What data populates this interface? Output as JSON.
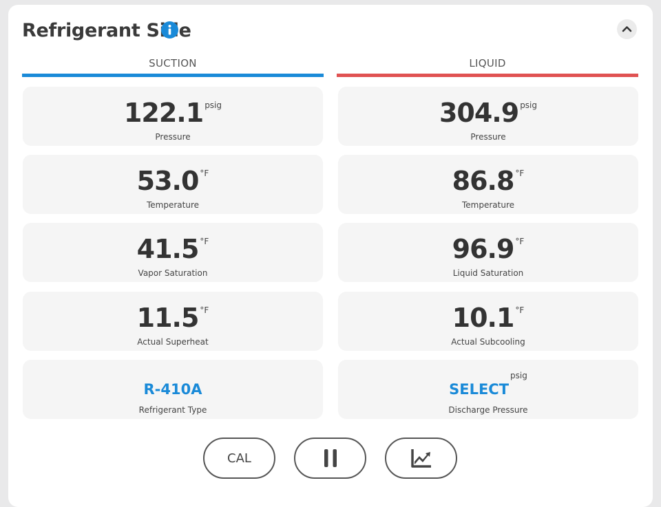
{
  "header": {
    "title": "Refrigerant Side"
  },
  "columns": [
    {
      "heading": "SUCTION",
      "color": "#1a8ad8",
      "tiles": [
        {
          "value": "122.1",
          "unit": "psig",
          "label": "Pressure"
        },
        {
          "value": "53.0",
          "unit": "°F",
          "label": "Temperature"
        },
        {
          "value": "41.5",
          "unit": "°F",
          "label": "Vapor Saturation"
        },
        {
          "value": "11.5",
          "unit": "°F",
          "label": "Actual Superheat"
        },
        {
          "value": "R-410A",
          "unit": "",
          "label": "Refrigerant Type"
        }
      ]
    },
    {
      "heading": "LIQUID",
      "color": "#e05252",
      "tiles": [
        {
          "value": "304.9",
          "unit": "psig",
          "label": "Pressure"
        },
        {
          "value": "86.8",
          "unit": "°F",
          "label": "Temperature"
        },
        {
          "value": "96.9",
          "unit": "°F",
          "label": "Liquid Saturation"
        },
        {
          "value": "10.1",
          "unit": "°F",
          "label": "Actual Subcooling"
        },
        {
          "value": "SELECT",
          "unit": "psig",
          "label": "Discharge Pressure"
        }
      ]
    }
  ],
  "buttons": {
    "cal": "CAL"
  },
  "icons": {
    "info": "info-icon",
    "collapse": "chevron-up-icon",
    "pause": "pause-icon",
    "chart": "trend-chart-icon"
  },
  "colors": {
    "accent": "#1a8ad8",
    "liquid": "#e05252"
  }
}
